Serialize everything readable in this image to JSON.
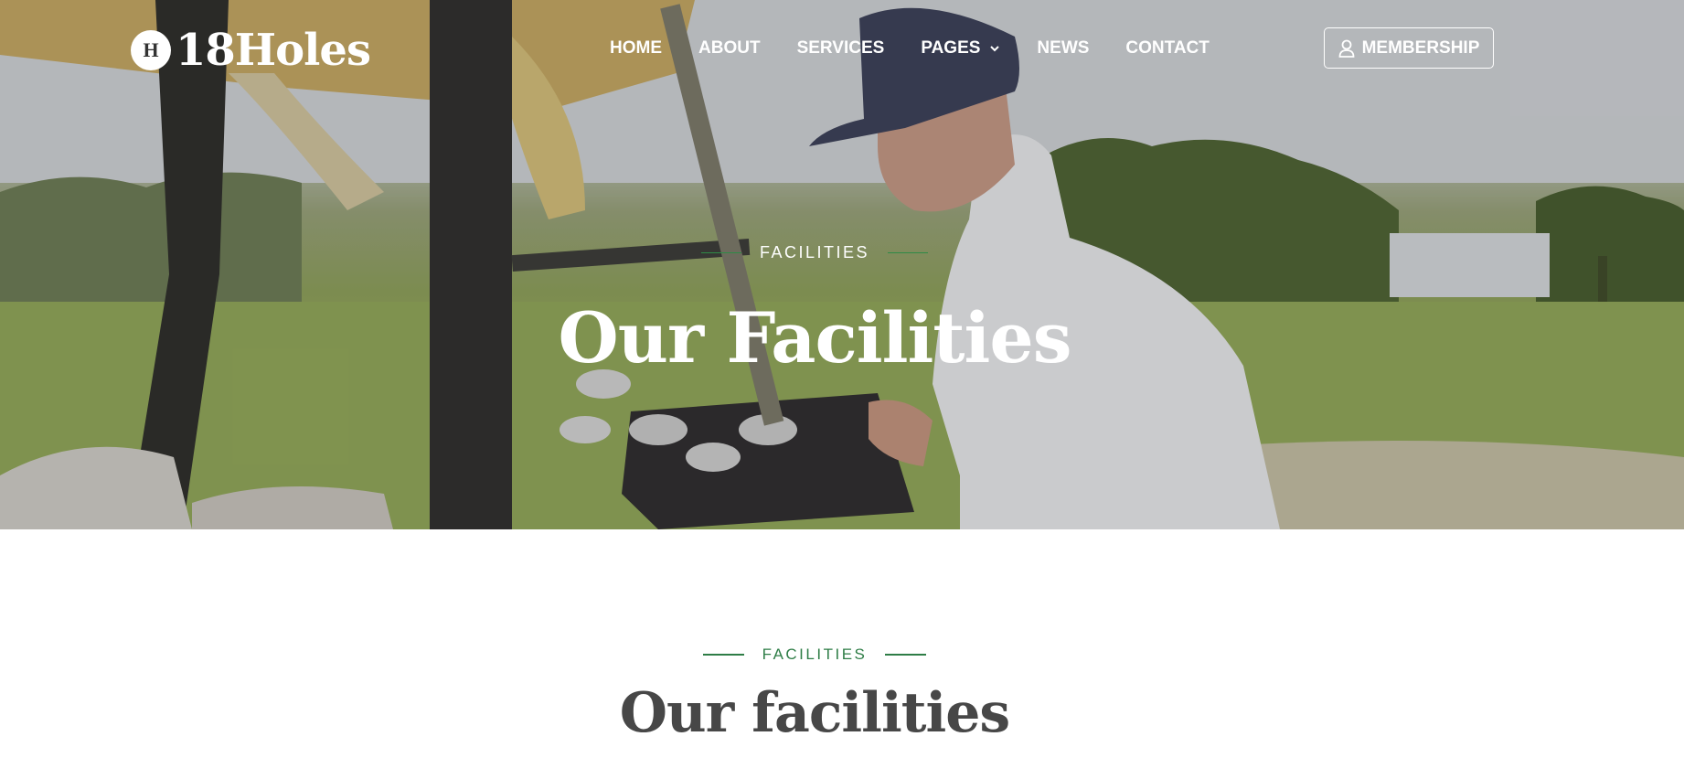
{
  "brand": {
    "badge_letter": "H",
    "name": "18Holes"
  },
  "nav": {
    "items": [
      {
        "label": "HOME"
      },
      {
        "label": "ABOUT"
      },
      {
        "label": "SERVICES"
      },
      {
        "label": "PAGES",
        "has_dropdown": true
      },
      {
        "label": "NEWS"
      },
      {
        "label": "CONTACT"
      }
    ],
    "membership_label": "MEMBERSHIP",
    "membership_icon": "user-icon"
  },
  "hero": {
    "eyebrow": "FACILITIES",
    "title": "Our Facilities"
  },
  "section": {
    "eyebrow": "FACILITIES",
    "title": "Our facilities"
  },
  "colors": {
    "accent_green": "#2e7d46",
    "heading_gray": "#474747"
  }
}
